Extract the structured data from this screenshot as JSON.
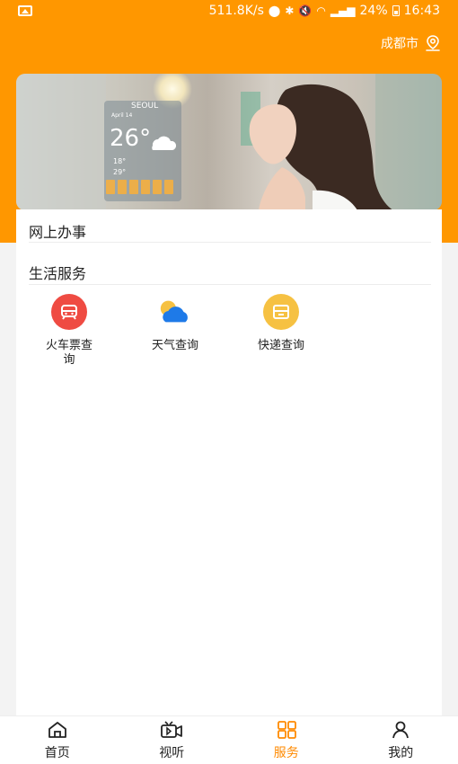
{
  "status_bar": {
    "speed": "511.8K/s",
    "battery": "24%",
    "time": "16:43"
  },
  "header": {
    "city": "成都市"
  },
  "banner": {
    "city_name": "SEOUL",
    "date": "April 14",
    "temperature": "26°",
    "low": "18°",
    "high": "29°"
  },
  "sections": [
    {
      "title": "网上办事"
    },
    {
      "title": "生活服务"
    }
  ],
  "services": [
    {
      "label": "火车票查询",
      "icon": "train-icon",
      "color": "#ef4b42"
    },
    {
      "label": "天气查询",
      "icon": "weather-icon",
      "color": "#1e7ae8"
    },
    {
      "label": "快递查询",
      "icon": "delivery-icon",
      "color": "#f6c142"
    }
  ],
  "nav": [
    {
      "label": "首页",
      "icon": "home-icon",
      "active": false
    },
    {
      "label": "视听",
      "icon": "video-icon",
      "active": false
    },
    {
      "label": "服务",
      "icon": "grid-icon",
      "active": true
    },
    {
      "label": "我的",
      "icon": "user-icon",
      "active": false
    }
  ],
  "colors": {
    "accent": "#ff9700",
    "nav_active": "#ff8a00"
  }
}
